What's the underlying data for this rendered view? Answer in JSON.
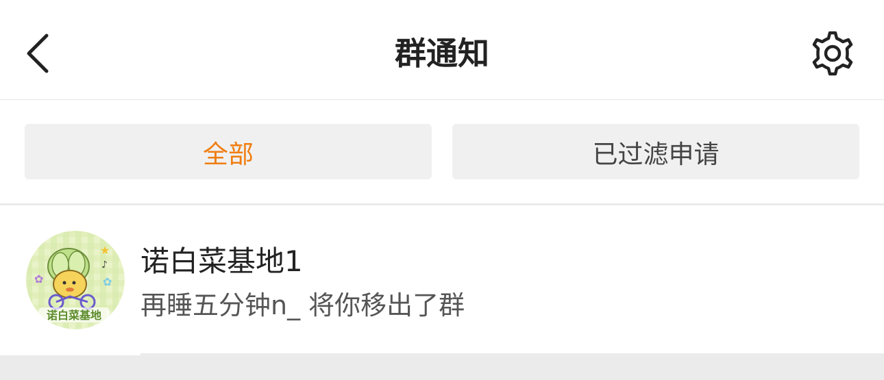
{
  "header": {
    "title": "群通知",
    "back_icon": "chevron-left-icon",
    "settings_icon": "gear-icon"
  },
  "tabs": [
    {
      "label": "全部",
      "active": true,
      "color": "#f07d10"
    },
    {
      "label": "已过滤申请",
      "active": false,
      "color": "#444444"
    }
  ],
  "notices": [
    {
      "group_name": "诺白菜基地1",
      "message": "再睡五分钟n_ 将你移出了群",
      "avatar_text": "诺白菜基地"
    }
  ],
  "colors": {
    "accent": "#f07d10",
    "tab_bg": "#f0f0f0",
    "divider": "#ebebeb"
  }
}
